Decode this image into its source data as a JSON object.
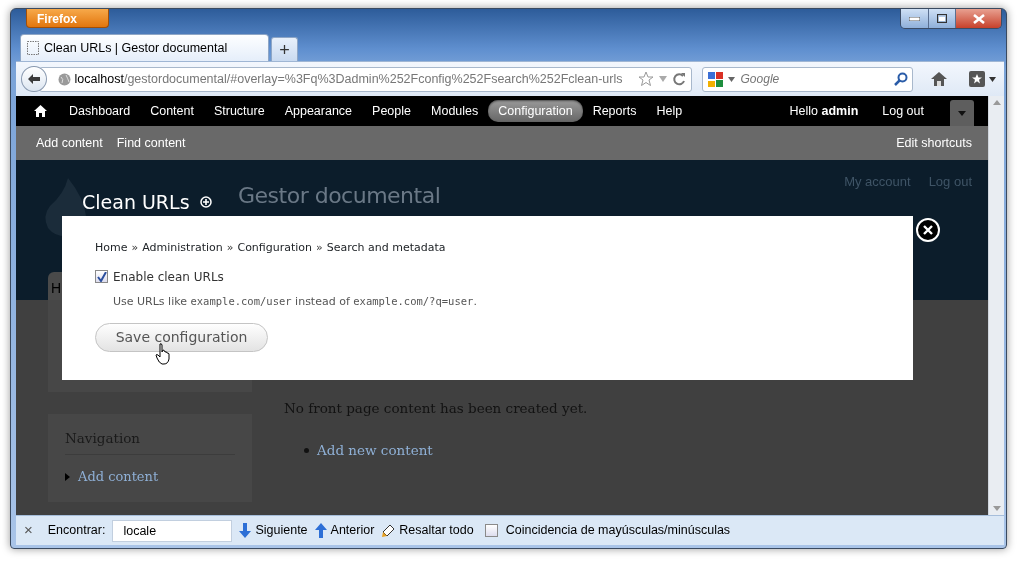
{
  "browser": {
    "menu_button": "Firefox",
    "tabs": [
      {
        "title": "Clean URLs | Gestor documental",
        "selected": true
      }
    ],
    "new_tab": "+",
    "url_host": "localhost",
    "url_path": "/gestordocumental/#overlay=%3Fq%3Dadmin%252Fconfig%252Fsearch%252Fclean-urls",
    "search_placeholder": "Google"
  },
  "toolbar": {
    "items": [
      {
        "label": "Dashboard",
        "selected": false
      },
      {
        "label": "Content",
        "selected": false
      },
      {
        "label": "Structure",
        "selected": false
      },
      {
        "label": "Appearance",
        "selected": false
      },
      {
        "label": "People",
        "selected": false
      },
      {
        "label": "Modules",
        "selected": false
      },
      {
        "label": "Configuration",
        "selected": true
      },
      {
        "label": "Reports",
        "selected": false
      },
      {
        "label": "Help",
        "selected": false
      }
    ],
    "greeting": "Hello **admin**",
    "logout": "Log out"
  },
  "shortcuts": {
    "items": [
      "Add content",
      "Find content"
    ],
    "edit": "Edit shortcuts"
  },
  "site": {
    "name": "Gestor documental",
    "links": [
      "My account",
      "Log out"
    ],
    "tab_fragment": "H"
  },
  "overlay": {
    "title": "Clean URLs",
    "breadcrumb": [
      {
        "kind": "link",
        "text": "Home"
      },
      {
        "kind": "separator",
        "text": "»"
      },
      {
        "kind": "link",
        "text": "Administration"
      },
      {
        "kind": "separator",
        "text": "»"
      },
      {
        "kind": "link",
        "text": "Configuration"
      },
      {
        "kind": "separator",
        "text": "»"
      },
      {
        "kind": "link",
        "text": "Search and metadata"
      }
    ],
    "checkbox": {
      "label": "Enable clean URLs",
      "checked": true
    },
    "description": [
      {
        "kind": "text",
        "text": "Use URLs like "
      },
      {
        "kind": "code",
        "text": "example.com/user"
      },
      {
        "kind": "text",
        "text": " instead of "
      },
      {
        "kind": "code",
        "text": "example.com/?q=user"
      },
      {
        "kind": "text",
        "text": "."
      }
    ],
    "button": "Save configuration"
  },
  "page": {
    "sidebar_title": "Navigation",
    "sidebar_links": [
      "Add content"
    ],
    "message": "No front page content has been created yet.",
    "links": [
      "Add new content"
    ]
  },
  "find_bar": {
    "close": "×",
    "label": "Encontrar:",
    "value": "locale",
    "next": "Siguiente",
    "previous": "Anterior",
    "highlight": "Resaltar todo",
    "match_case": {
      "label": "Coincidencia de mayúsculas/minúsculas",
      "checked": false
    }
  }
}
